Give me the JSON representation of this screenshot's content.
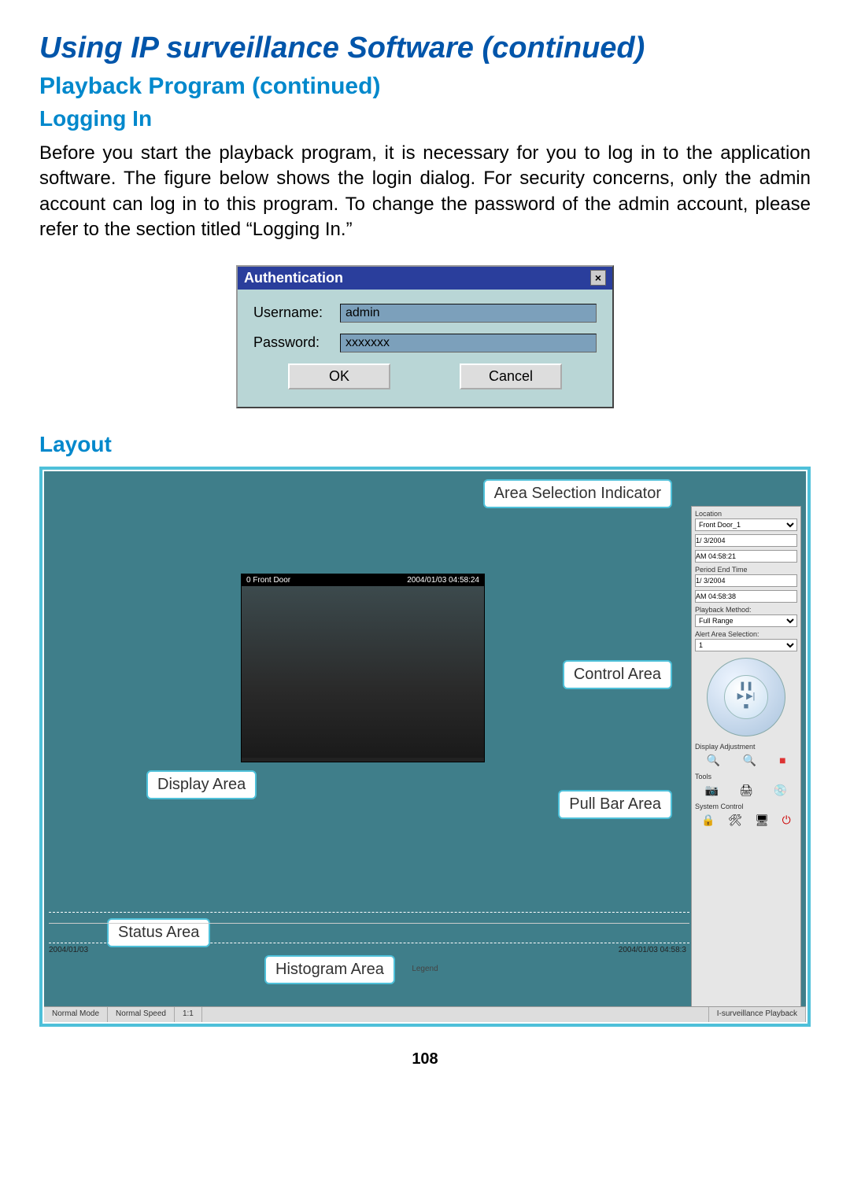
{
  "page": {
    "title": "Using IP surveillance Software (continued)",
    "section": "Playback Program (continued)",
    "subsection1": "Logging In",
    "paragraph": "Before you start the playback program, it is necessary for you to log in to the application software. The figure below shows the login dialog. For security concerns, only the admin account can log in to this program. To change the password of the admin account, please refer to the section titled “Logging In.”",
    "subsection2": "Layout",
    "page_number": "108"
  },
  "auth_dialog": {
    "title": "Authentication",
    "username_label": "Username:",
    "username_value": "admin",
    "password_label": "Password:",
    "password_value": "xxxxxxx",
    "ok": "OK",
    "cancel": "Cancel",
    "close": "×"
  },
  "callouts": {
    "area_selection": "Area Selection Indicator",
    "control_area": "Control  Area",
    "display_area": "Display Area",
    "pull_bar": "Pull Bar  Area",
    "status_area": "Status Area",
    "histogram_area": "Histogram Area"
  },
  "video": {
    "camera": "0    Front Door",
    "timestamp": "2004/01/03 04:58:24"
  },
  "control_panel": {
    "location_label": "Location",
    "location_value": "Front Door_1",
    "date1": "1/ 3/2004",
    "time1": "AM 04:58:21",
    "end_label": "Period End Time",
    "date2": "1/ 3/2004",
    "time2": "AM 04:58:38",
    "method_label": "Playback Method:",
    "method_value": "Full Range",
    "alert_label": "Alert Area Selection:",
    "alert_value": "1",
    "display_adj": "Display Adjustment",
    "tools": "Tools",
    "system_control": "System Control"
  },
  "histogram": {
    "ts_left": "2004/01/03",
    "legend": "Legend",
    "ts_right": "2004/01/03 04:58:3"
  },
  "statusbar": {
    "mode": "Normal Mode",
    "speed": "Normal Speed",
    "ratio": "1:1",
    "app": "I-surveillance Playback"
  }
}
